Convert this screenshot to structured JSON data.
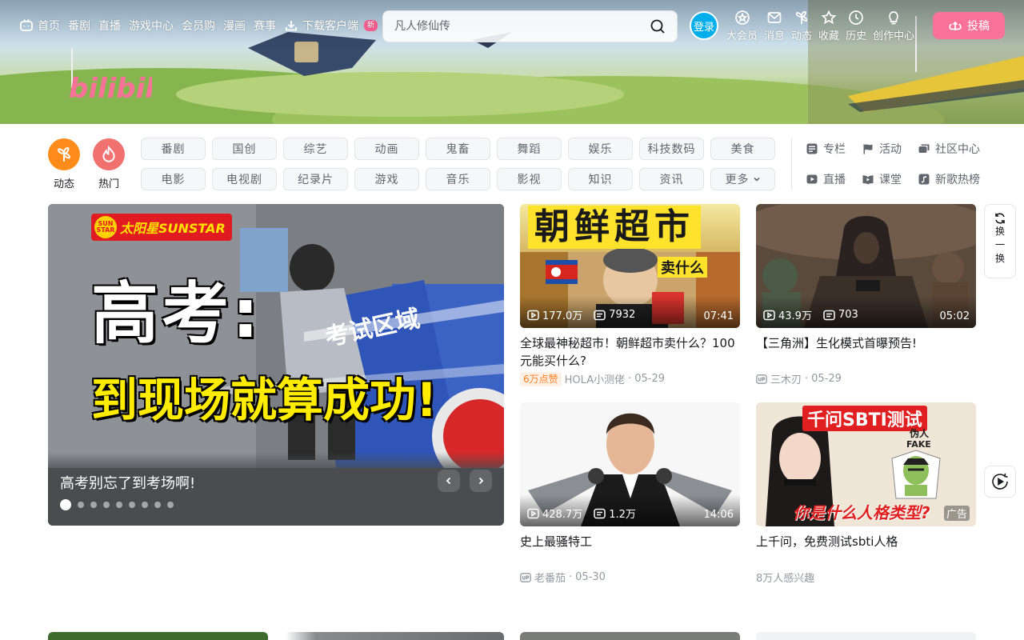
{
  "header": {
    "nav": [
      {
        "label": "首页",
        "icon": "tv-icon"
      },
      {
        "label": "番剧"
      },
      {
        "label": "直播"
      },
      {
        "label": "游戏中心"
      },
      {
        "label": "会员购"
      },
      {
        "label": "漫画"
      },
      {
        "label": "赛事"
      },
      {
        "label": "下载客户端",
        "icon": "download-icon",
        "badge": "新"
      }
    ],
    "search_placeholder": "凡人修仙传",
    "login_label": "登录",
    "right_entries": [
      {
        "label": "大会员",
        "icon": "vip-icon"
      },
      {
        "label": "消息",
        "icon": "mail-icon"
      },
      {
        "label": "动态",
        "icon": "windmill-icon"
      },
      {
        "label": "收藏",
        "icon": "star-icon"
      },
      {
        "label": "历史",
        "icon": "clock-icon"
      },
      {
        "label": "创作中心",
        "icon": "bulb-icon"
      }
    ],
    "upload_label": "投稿",
    "logo_text": "bilibili"
  },
  "quick_entries": [
    {
      "label": "动态",
      "color": "#ff8c1a"
    },
    {
      "label": "热门",
      "color": "#f0716f"
    }
  ],
  "channels": [
    "番剧",
    "国创",
    "综艺",
    "动画",
    "鬼畜",
    "舞蹈",
    "娱乐",
    "科技数码",
    "美食",
    "电影",
    "电视剧",
    "纪录片",
    "游戏",
    "音乐",
    "影视",
    "知识",
    "资讯",
    "更多"
  ],
  "extras": [
    {
      "label": "专栏"
    },
    {
      "label": "活动"
    },
    {
      "label": "社区中心"
    },
    {
      "label": "直播"
    },
    {
      "label": "课堂"
    },
    {
      "label": "新歌热榜"
    }
  ],
  "carousel": {
    "brand": "太阳星SUNSTAR",
    "brand_logo": "SUN STAR",
    "headline": "高考:",
    "subline": "到现场就算成功!",
    "sign": "考试区域",
    "title": "高考别忘了到考场啊!",
    "dot_count": 9,
    "active_dot": 0
  },
  "videos": [
    {
      "thumb_text": "朝鲜超市",
      "thumb_sub": "卖什么",
      "plays": "177.0万",
      "danmaku": "7932",
      "duration": "07:41",
      "title": "全球最神秘超市！朝鲜超市卖什么？100元能买什么?",
      "like_tag": "6万点赞",
      "author": "HOLA小测佬",
      "date": "05-29"
    },
    {
      "plays": "43.9万",
      "danmaku": "703",
      "duration": "05:02",
      "title": "【三角洲】生化模式首曝预告!",
      "author": "三木刃",
      "date": "05-29"
    },
    {
      "plays": "428.7万",
      "danmaku": "1.2万",
      "duration": "14:06",
      "title": "史上最骚特工",
      "author": "老番茄",
      "date": "05-30"
    },
    {
      "thumb_text": "千问SBTI测试",
      "thumb_sub": "你是什么人格类型?",
      "thumb_note1": "伪人",
      "thumb_note2": "FAKE",
      "ad_label": "广告",
      "title": "上千问，免费测试sbti人格",
      "interest": "8万人感兴趣"
    }
  ],
  "side": {
    "refresh_label": "换一换"
  },
  "colors": {
    "brand_pink": "#fb7299",
    "brand_blue": "#00aeec"
  }
}
